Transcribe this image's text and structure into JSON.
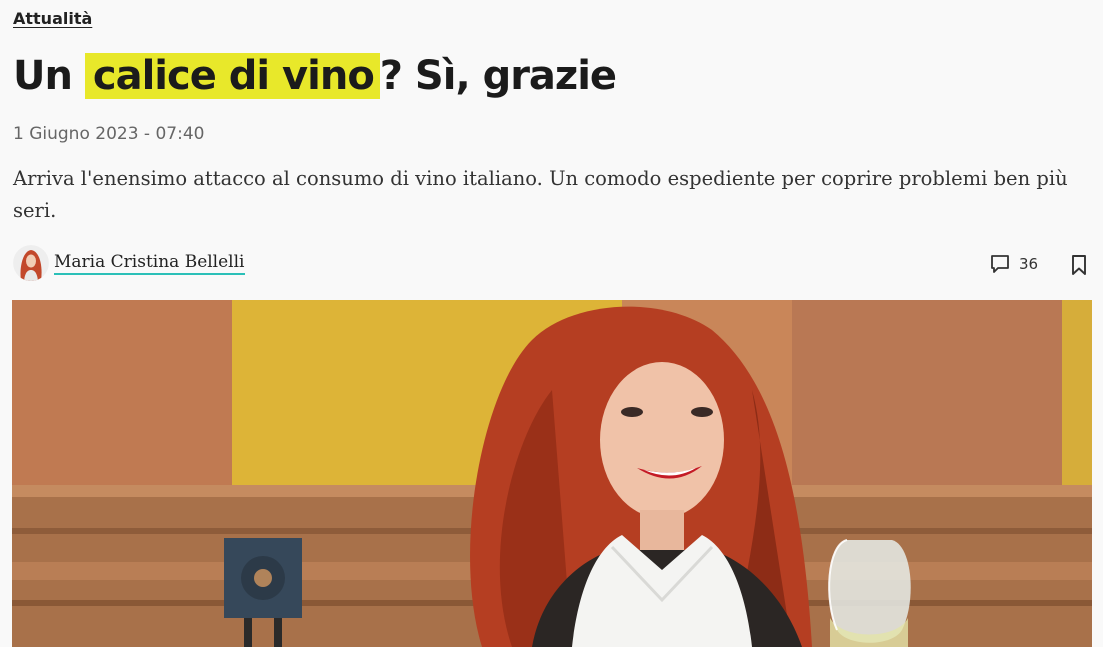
{
  "article": {
    "category": "Attualità",
    "title_before": "Un ",
    "title_highlight": "calice di vino",
    "title_after": "? Sì, grazie",
    "date": "1 Giugno 2023 - 07:40",
    "subtitle": "Arriva l'enensimo attacco al consumo di vino italiano. Un comodo espediente per coprire problemi ben più seri.",
    "author": "Maria Cristina Bellelli",
    "comments_count": "36"
  },
  "icons": {
    "comments": "speech-bubble-icon",
    "bookmark": "bookmark-icon"
  },
  "colors": {
    "highlight": "#e8e82a",
    "author_underline": "#2bc0b8",
    "background": "#f9f9f9"
  }
}
